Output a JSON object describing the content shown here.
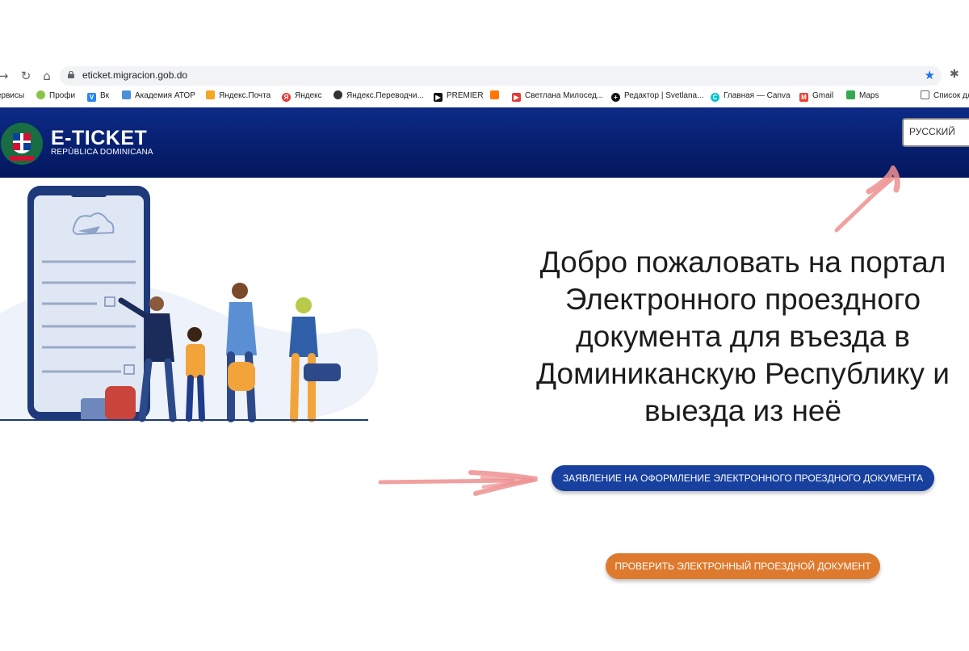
{
  "browser": {
    "url": "eticket.migracion.gob.do",
    "bookmarks": [
      {
        "label": "ервисы",
        "color": "#ffffff"
      },
      {
        "label": "Профи",
        "color": "#8bc34a"
      },
      {
        "label": "Вк",
        "color": "#2787f5"
      },
      {
        "label": "Академия АТОР",
        "color": "#4a90d9"
      },
      {
        "label": "Яндекс.Почта",
        "color": "#f5a623"
      },
      {
        "label": "Яндекс",
        "color": "#e53935"
      },
      {
        "label": "Яндекс.Переводчи...",
        "color": "#333333"
      },
      {
        "label": "PREMIER",
        "color": "#111111"
      },
      {
        "label": "Светлана Милосед...",
        "color": "#ff7700"
      },
      {
        "label": "Редактор | Svetlana...",
        "color": "#111111"
      },
      {
        "label": "Главная — Canva",
        "color": "#00c4cc"
      },
      {
        "label": "Gmail",
        "color": "#ea4335"
      },
      {
        "label": "Maps",
        "color": "#34a853"
      },
      {
        "label": "Список для",
        "color": "#666666"
      }
    ]
  },
  "header": {
    "title": "E-TICKET",
    "subtitle": "REPÚBLICA DOMINICANA",
    "language": "РУССКИЙ"
  },
  "hero": {
    "title": "Добро пожаловать на портал Электронного проездного документа для въезда в Доминиканскую Республику и выезда из неё",
    "apply_button": "ЗАЯВЛЕНИЕ НА ОФОРМЛЕНИЕ ЭЛЕКТРОННОГО ПРОЕЗДНОГО ДОКУМЕНТА",
    "check_button": "ПРОВЕРИТЬ ЭЛЕКТРОННЫЙ ПРОЕЗДНОЙ ДОКУМЕНТ"
  },
  "colors": {
    "header": "#0c2a86",
    "apply": "#17409f",
    "check": "#dd7a2e",
    "annotation": "#e98a8a"
  }
}
